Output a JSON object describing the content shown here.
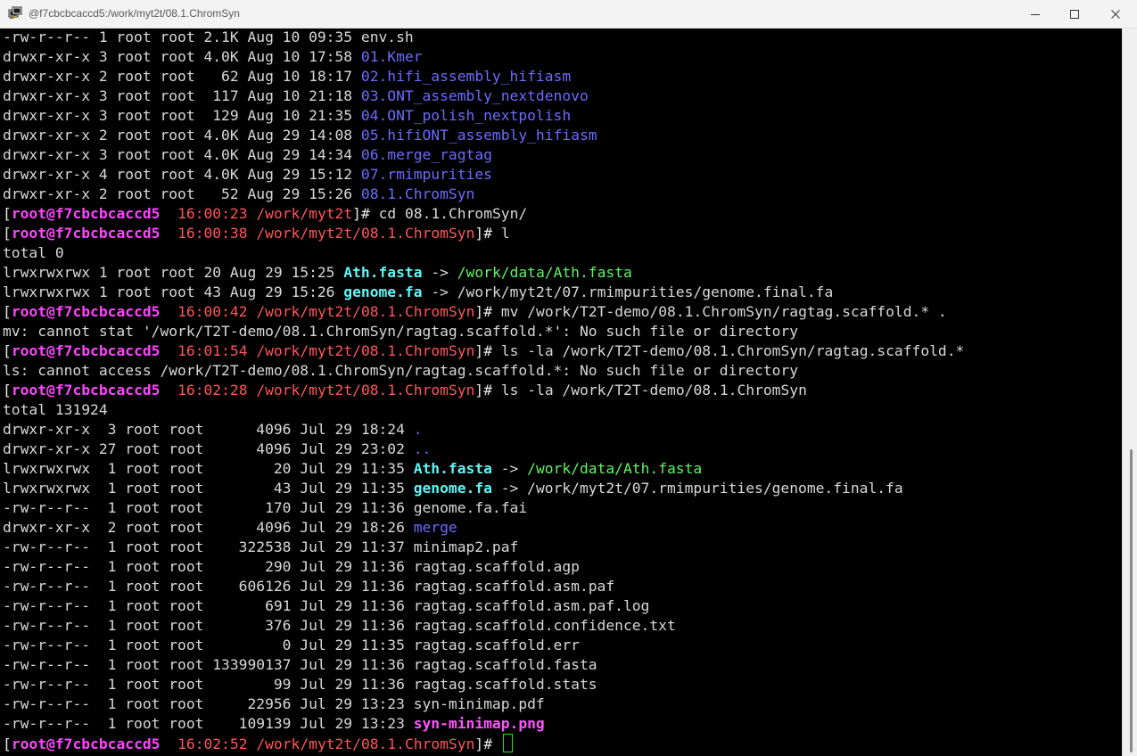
{
  "window": {
    "title": "@f7cbcbcaccd5:/work/myt2t/08.1.ChromSyn",
    "icon": "putty-terminal-icon"
  },
  "prompt": {
    "user": "root",
    "at": "@",
    "host": "f7cbcbcaccd5"
  },
  "colors": {
    "background": "#000000",
    "directory": "#6b6bff",
    "symlink": "#5ff5f5",
    "symlink_target": "#5ff55f",
    "image_file": "#ff55ff",
    "prompt_user": "#ff44ff",
    "prompt_path": "#ff5555",
    "cursor": "#22e022"
  },
  "lines": [
    {
      "prefix": "-rw-r--r-- 1 root root 2.1K Aug 10 09:35 ",
      "name": "env.sh",
      "kind": "file"
    },
    {
      "prefix": "drwxr-xr-x 3 root root 4.0K Aug 10 17:58 ",
      "name": "01.Kmer",
      "kind": "dir"
    },
    {
      "prefix": "drwxr-xr-x 2 root root   62 Aug 10 18:17 ",
      "name": "02.hifi_assembly_hifiasm",
      "kind": "dir"
    },
    {
      "prefix": "drwxr-xr-x 3 root root  117 Aug 10 21:18 ",
      "name": "03.ONT_assembly_nextdenovo",
      "kind": "dir"
    },
    {
      "prefix": "drwxr-xr-x 3 root root  129 Aug 10 21:35 ",
      "name": "04.ONT_polish_nextpolish",
      "kind": "dir"
    },
    {
      "prefix": "drwxr-xr-x 2 root root 4.0K Aug 29 14:08 ",
      "name": "05.hifiONT_assembly_hifiasm",
      "kind": "dir"
    },
    {
      "prefix": "drwxr-xr-x 3 root root 4.0K Aug 29 14:34 ",
      "name": "06.merge_ragtag",
      "kind": "dir"
    },
    {
      "prefix": "drwxr-xr-x 4 root root 4.0K Aug 29 15:12 ",
      "name": "07.rmimpurities",
      "kind": "dir"
    },
    {
      "prefix": "drwxr-xr-x 2 root root   52 Aug 29 15:26 ",
      "name": "08.1.ChromSyn",
      "kind": "dir"
    },
    {
      "kind": "prompt",
      "time": "16:00:23",
      "path": "/work/myt2t",
      "command": "cd 08.1.ChromSyn/"
    },
    {
      "kind": "prompt",
      "time": "16:00:38",
      "path": "/work/myt2t/08.1.ChromSyn",
      "command": "l"
    },
    {
      "kind": "text",
      "text": "total 0"
    },
    {
      "prefix": "lrwxrwxrwx 1 root root 20 Aug 29 15:25 ",
      "name": "Ath.fasta",
      "kind": "link",
      "arrow": " -> ",
      "target": "/work/data/Ath.fasta",
      "target_kind": "target"
    },
    {
      "prefix": "lrwxrwxrwx 1 root root 43 Aug 29 15:26 ",
      "name": "genome.fa",
      "kind": "link",
      "arrow": " -> ",
      "target": "/work/myt2t/07.rmimpurities/genome.final.fa",
      "target_kind": "plain"
    },
    {
      "kind": "prompt",
      "time": "16:00:42",
      "path": "/work/myt2t/08.1.ChromSyn",
      "command": "mv /work/T2T-demo/08.1.ChromSyn/ragtag.scaffold.* ."
    },
    {
      "kind": "text",
      "text": "mv: cannot stat '/work/T2T-demo/08.1.ChromSyn/ragtag.scaffold.*': No such file or directory"
    },
    {
      "kind": "prompt",
      "time": "16:01:54",
      "path": "/work/myt2t/08.1.ChromSyn",
      "command": "ls -la /work/T2T-demo/08.1.ChromSyn/ragtag.scaffold.*"
    },
    {
      "kind": "text",
      "text": "ls: cannot access /work/T2T-demo/08.1.ChromSyn/ragtag.scaffold.*: No such file or directory"
    },
    {
      "kind": "prompt",
      "time": "16:02:28",
      "path": "/work/myt2t/08.1.ChromSyn",
      "command": "ls -la /work/T2T-demo/08.1.ChromSyn"
    },
    {
      "kind": "text",
      "text": "total 131924"
    },
    {
      "prefix": "drwxr-xr-x  3 root root      4096 Jul 29 18:24 ",
      "name": ".",
      "kind": "dir"
    },
    {
      "prefix": "drwxr-xr-x 27 root root      4096 Jul 29 23:02 ",
      "name": "..",
      "kind": "dir"
    },
    {
      "prefix": "lrwxrwxrwx  1 root root        20 Jul 29 11:35 ",
      "name": "Ath.fasta",
      "kind": "link",
      "arrow": " -> ",
      "target": "/work/data/Ath.fasta",
      "target_kind": "target"
    },
    {
      "prefix": "lrwxrwxrwx  1 root root        43 Jul 29 11:35 ",
      "name": "genome.fa",
      "kind": "link",
      "arrow": " -> ",
      "target": "/work/myt2t/07.rmimpurities/genome.final.fa",
      "target_kind": "plain"
    },
    {
      "prefix": "-rw-r--r--  1 root root       170 Jul 29 11:36 ",
      "name": "genome.fa.fai",
      "kind": "file"
    },
    {
      "prefix": "drwxr-xr-x  2 root root      4096 Jul 29 18:26 ",
      "name": "merge",
      "kind": "dir"
    },
    {
      "prefix": "-rw-r--r--  1 root root    322538 Jul 29 11:37 ",
      "name": "minimap2.paf",
      "kind": "file"
    },
    {
      "prefix": "-rw-r--r--  1 root root       290 Jul 29 11:36 ",
      "name": "ragtag.scaffold.agp",
      "kind": "file"
    },
    {
      "prefix": "-rw-r--r--  1 root root    606126 Jul 29 11:36 ",
      "name": "ragtag.scaffold.asm.paf",
      "kind": "file"
    },
    {
      "prefix": "-rw-r--r--  1 root root       691 Jul 29 11:36 ",
      "name": "ragtag.scaffold.asm.paf.log",
      "kind": "file"
    },
    {
      "prefix": "-rw-r--r--  1 root root       376 Jul 29 11:36 ",
      "name": "ragtag.scaffold.confidence.txt",
      "kind": "file"
    },
    {
      "prefix": "-rw-r--r--  1 root root         0 Jul 29 11:35 ",
      "name": "ragtag.scaffold.err",
      "kind": "file"
    },
    {
      "prefix": "-rw-r--r--  1 root root 133990137 Jul 29 11:36 ",
      "name": "ragtag.scaffold.fasta",
      "kind": "file"
    },
    {
      "prefix": "-rw-r--r--  1 root root        99 Jul 29 11:36 ",
      "name": "ragtag.scaffold.stats",
      "kind": "file"
    },
    {
      "prefix": "-rw-r--r--  1 root root     22956 Jul 29 13:23 ",
      "name": "syn-minimap.pdf",
      "kind": "file"
    },
    {
      "prefix": "-rw-r--r--  1 root root    109139 Jul 29 13:23 ",
      "name": "syn-minimap.png",
      "kind": "img"
    },
    {
      "kind": "prompt",
      "time": "16:02:52",
      "path": "/work/myt2t/08.1.ChromSyn",
      "command": "",
      "cursor": true
    }
  ]
}
